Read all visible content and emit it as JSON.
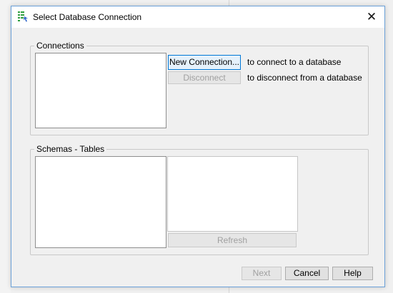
{
  "window": {
    "title": "Select Database Connection",
    "close_glyph": "✕"
  },
  "connections": {
    "group_label": "Connections",
    "new_connection_label": "New Connection...",
    "new_connection_hint": "to connect to a database",
    "disconnect_label": "Disconnect",
    "disconnect_hint": "to disconnect from a database",
    "items": []
  },
  "schemas": {
    "group_label": "Schemas - Tables",
    "schemas_items": [],
    "tables_items": [],
    "refresh_label": "Refresh"
  },
  "footer": {
    "next_label": "Next",
    "cancel_label": "Cancel",
    "help_label": "Help"
  },
  "colors": {
    "accent": "#0078d7",
    "dialog_border": "#6aa0d8",
    "icon_green": "#2e9e3f"
  }
}
